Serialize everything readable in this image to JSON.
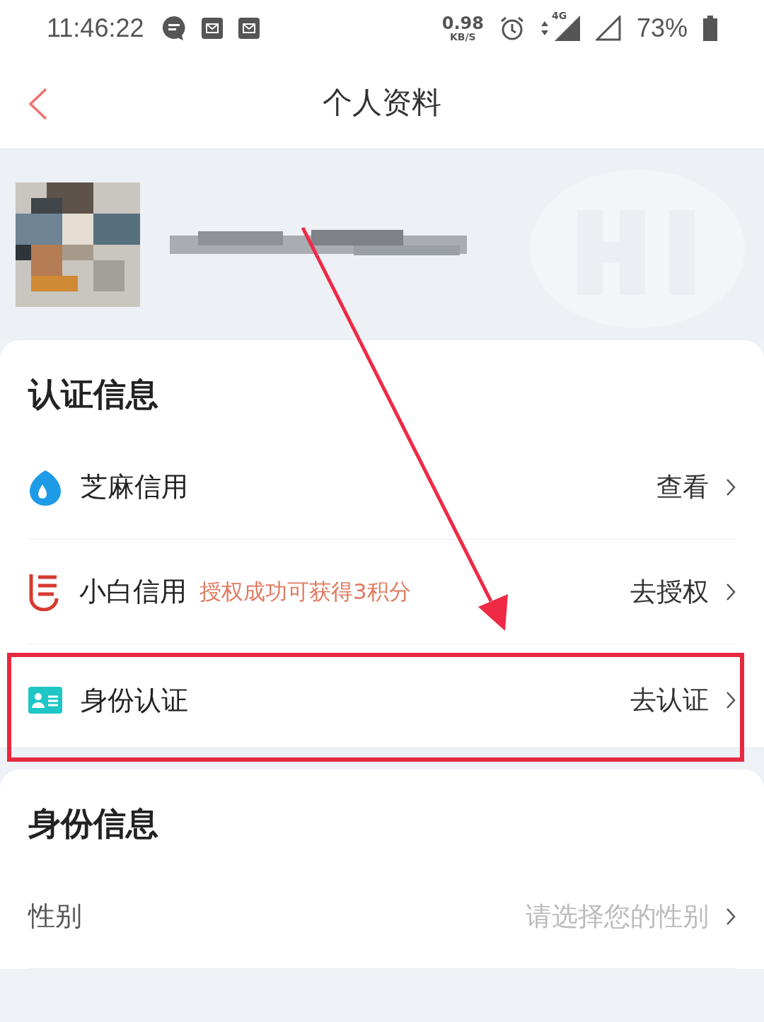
{
  "status_bar": {
    "time": "11:46:22",
    "speed": "0.98",
    "speed_unit": "KB/S",
    "network": "4G",
    "battery": "73%"
  },
  "nav": {
    "title": "个人资料"
  },
  "sections": [
    {
      "title": "认证信息",
      "rows": [
        {
          "kind": "sesame",
          "label": "芝麻信用",
          "action": "查看",
          "highlighted": false
        },
        {
          "kind": "xiaobai",
          "label": "小白信用",
          "note": "授权成功可获得3积分",
          "action": "去授权",
          "highlighted": false
        },
        {
          "kind": "idcard",
          "label": "身份认证",
          "action": "去认证",
          "highlighted": true
        }
      ]
    },
    {
      "title": "身份信息",
      "rows": [
        {
          "kind": "plain",
          "label": "性别",
          "placeholder": "请选择您的性别",
          "highlighted": false
        }
      ]
    }
  ]
}
